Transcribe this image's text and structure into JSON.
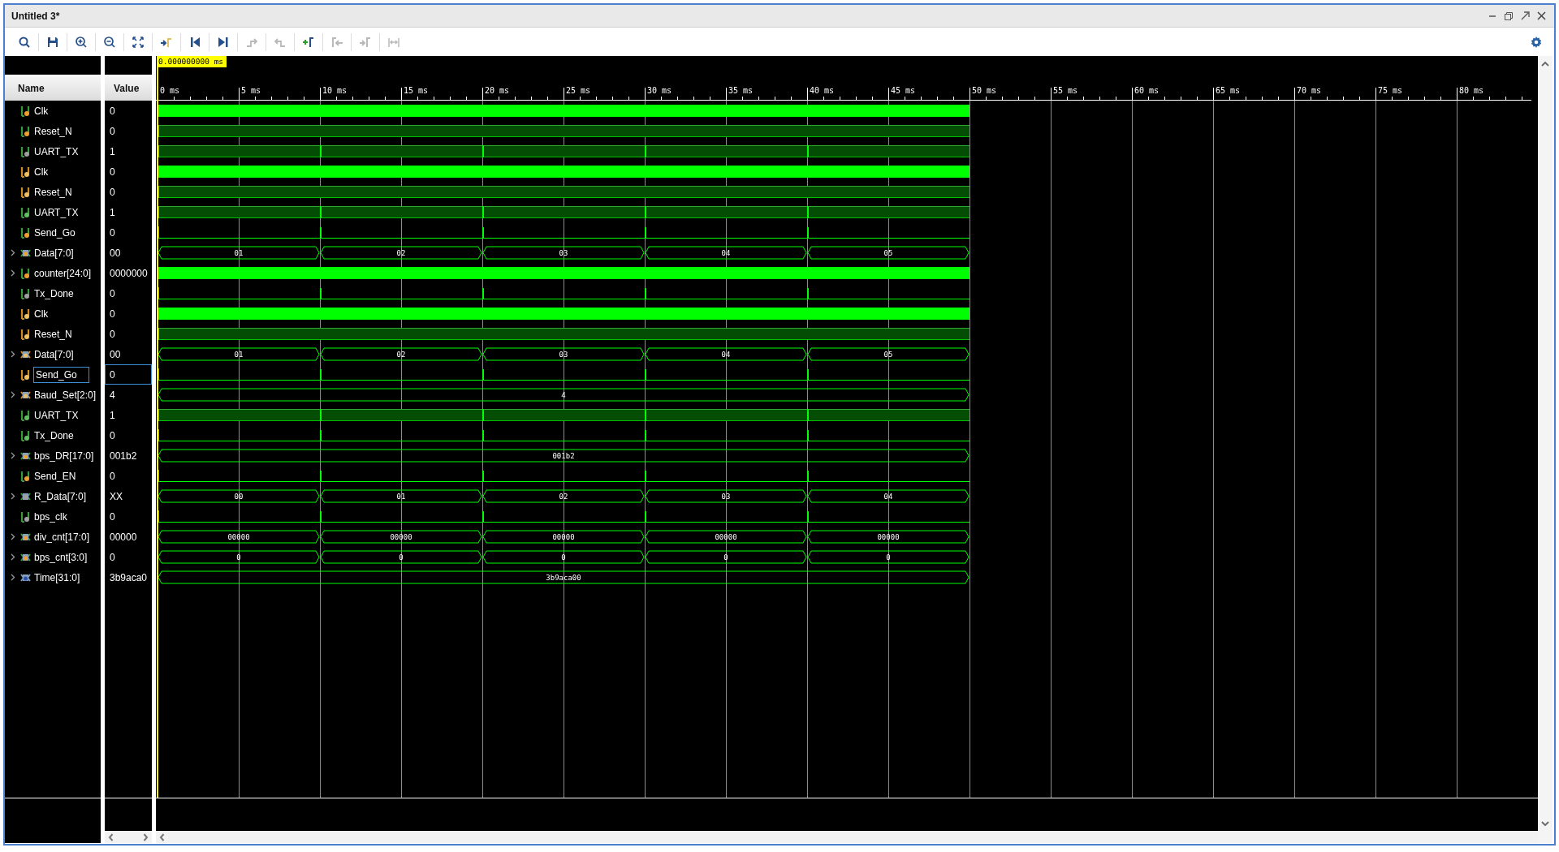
{
  "window": {
    "title": "Untitled 3*"
  },
  "toolbar": [
    {
      "disabled": false
    },
    {
      "disabled": false
    },
    {
      "disabled": false
    },
    {
      "disabled": false
    },
    {
      "disabled": false
    },
    {
      "disabled": false
    },
    {
      "disabled": false
    },
    {
      "disabled": false
    },
    {
      "disabled": true
    },
    {
      "disabled": true
    },
    {
      "disabled": false
    },
    {
      "disabled": true
    },
    {
      "disabled": true
    },
    {
      "disabled": true
    }
  ],
  "columns": {
    "name": "Name",
    "value": "Value"
  },
  "ruler": {
    "cursor": "0.000000000 ms",
    "labels": [
      "0 ms",
      "5 ms",
      "10 ms",
      "15 ms",
      "20 ms",
      "25 ms",
      "30 ms",
      "35 ms",
      "40 ms",
      "45 ms",
      "50 ms",
      "55 ms",
      "60 ms",
      "65 ms",
      "70 ms",
      "75 ms",
      "80 ms"
    ]
  },
  "signals": [
    {
      "name": "Clk",
      "value": "0",
      "kind": "in",
      "expandable": false,
      "selected": false,
      "wave": {
        "kind": "clock"
      }
    },
    {
      "name": "Reset_N",
      "value": "0",
      "kind": "in",
      "expandable": false,
      "selected": false,
      "wave": {
        "kind": "high"
      }
    },
    {
      "name": "UART_TX",
      "value": "1",
      "kind": "out",
      "expandable": false,
      "selected": false,
      "wave": {
        "kind": "high-pulses"
      }
    },
    {
      "name": "Clk",
      "value": "0",
      "kind": "reg",
      "expandable": false,
      "selected": false,
      "wave": {
        "kind": "clock"
      }
    },
    {
      "name": "Reset_N",
      "value": "0",
      "kind": "reg",
      "expandable": false,
      "selected": false,
      "wave": {
        "kind": "high"
      }
    },
    {
      "name": "UART_TX",
      "value": "1",
      "kind": "wire",
      "expandable": false,
      "selected": false,
      "wave": {
        "kind": "high-pulses"
      }
    },
    {
      "name": "Send_Go",
      "value": "0",
      "kind": "in",
      "expandable": false,
      "selected": false,
      "wave": {
        "kind": "low-pulses"
      }
    },
    {
      "name": "Data[7:0]",
      "value": "00",
      "kind": "in",
      "expandable": true,
      "selected": false,
      "wave": {
        "kind": "bus",
        "segments": [
          "01",
          "02",
          "03",
          "04",
          "05"
        ]
      }
    },
    {
      "name": "counter[24:0]",
      "value": "0000000",
      "kind": "in",
      "expandable": true,
      "selected": false,
      "wave": {
        "kind": "clock"
      }
    },
    {
      "name": "Tx_Done",
      "value": "0",
      "kind": "out",
      "expandable": false,
      "selected": false,
      "wave": {
        "kind": "low-pulses"
      }
    },
    {
      "name": "Clk",
      "value": "0",
      "kind": "reg",
      "expandable": false,
      "selected": false,
      "wave": {
        "kind": "clock"
      }
    },
    {
      "name": "Reset_N",
      "value": "0",
      "kind": "reg",
      "expandable": false,
      "selected": false,
      "wave": {
        "kind": "high"
      }
    },
    {
      "name": "Data[7:0]",
      "value": "00",
      "kind": "reg",
      "expandable": true,
      "selected": false,
      "wave": {
        "kind": "bus",
        "segments": [
          "01",
          "02",
          "03",
          "04",
          "05"
        ]
      }
    },
    {
      "name": "Send_Go",
      "value": "0",
      "kind": "reg",
      "expandable": false,
      "selected": true,
      "wave": {
        "kind": "low-pulses"
      }
    },
    {
      "name": "Baud_Set[2:0]",
      "value": "4",
      "kind": "reg",
      "expandable": true,
      "selected": false,
      "wave": {
        "kind": "bus",
        "segments": [
          "4"
        ]
      }
    },
    {
      "name": "UART_TX",
      "value": "1",
      "kind": "wire",
      "expandable": false,
      "selected": false,
      "wave": {
        "kind": "high-pulses"
      }
    },
    {
      "name": "Tx_Done",
      "value": "0",
      "kind": "wire",
      "expandable": false,
      "selected": false,
      "wave": {
        "kind": "low-pulses"
      }
    },
    {
      "name": "bps_DR[17:0]",
      "value": "001b2",
      "kind": "in",
      "expandable": true,
      "selected": false,
      "wave": {
        "kind": "bus",
        "segments": [
          "001b2"
        ]
      }
    },
    {
      "name": "Send_EN",
      "value": "0",
      "kind": "in",
      "expandable": false,
      "selected": false,
      "wave": {
        "kind": "low-pulses"
      }
    },
    {
      "name": "R_Data[7:0]",
      "value": "XX",
      "kind": "out",
      "expandable": true,
      "selected": false,
      "wave": {
        "kind": "bus",
        "segments": [
          "00",
          "01",
          "02",
          "03",
          "04"
        ]
      }
    },
    {
      "name": "bps_clk",
      "value": "0",
      "kind": "out",
      "expandable": false,
      "selected": false,
      "wave": {
        "kind": "low-pulses"
      }
    },
    {
      "name": "div_cnt[17:0]",
      "value": "00000",
      "kind": "in",
      "expandable": true,
      "selected": false,
      "wave": {
        "kind": "bus",
        "segments": [
          "00000",
          "00000",
          "00000",
          "00000",
          "00000"
        ]
      }
    },
    {
      "name": "bps_cnt[3:0]",
      "value": "0",
      "kind": "in",
      "expandable": true,
      "selected": false,
      "wave": {
        "kind": "bus",
        "segments": [
          "0",
          "0",
          "0",
          "0",
          "0"
        ]
      }
    },
    {
      "name": "Time[31:0]",
      "value": "3b9aca0",
      "kind": "const",
      "expandable": true,
      "selected": false,
      "wave": {
        "kind": "bus",
        "segments": [
          "3b9aca00"
        ]
      }
    }
  ]
}
